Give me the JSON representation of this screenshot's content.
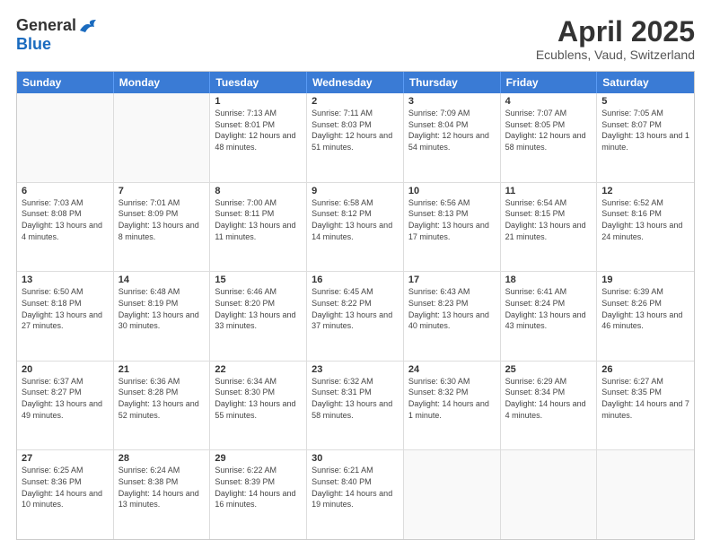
{
  "logo": {
    "general": "General",
    "blue": "Blue"
  },
  "title": "April 2025",
  "subtitle": "Ecublens, Vaud, Switzerland",
  "header_days": [
    "Sunday",
    "Monday",
    "Tuesday",
    "Wednesday",
    "Thursday",
    "Friday",
    "Saturday"
  ],
  "weeks": [
    [
      {
        "day": "",
        "info": ""
      },
      {
        "day": "",
        "info": ""
      },
      {
        "day": "1",
        "info": "Sunrise: 7:13 AM\nSunset: 8:01 PM\nDaylight: 12 hours and 48 minutes."
      },
      {
        "day": "2",
        "info": "Sunrise: 7:11 AM\nSunset: 8:03 PM\nDaylight: 12 hours and 51 minutes."
      },
      {
        "day": "3",
        "info": "Sunrise: 7:09 AM\nSunset: 8:04 PM\nDaylight: 12 hours and 54 minutes."
      },
      {
        "day": "4",
        "info": "Sunrise: 7:07 AM\nSunset: 8:05 PM\nDaylight: 12 hours and 58 minutes."
      },
      {
        "day": "5",
        "info": "Sunrise: 7:05 AM\nSunset: 8:07 PM\nDaylight: 13 hours and 1 minute."
      }
    ],
    [
      {
        "day": "6",
        "info": "Sunrise: 7:03 AM\nSunset: 8:08 PM\nDaylight: 13 hours and 4 minutes."
      },
      {
        "day": "7",
        "info": "Sunrise: 7:01 AM\nSunset: 8:09 PM\nDaylight: 13 hours and 8 minutes."
      },
      {
        "day": "8",
        "info": "Sunrise: 7:00 AM\nSunset: 8:11 PM\nDaylight: 13 hours and 11 minutes."
      },
      {
        "day": "9",
        "info": "Sunrise: 6:58 AM\nSunset: 8:12 PM\nDaylight: 13 hours and 14 minutes."
      },
      {
        "day": "10",
        "info": "Sunrise: 6:56 AM\nSunset: 8:13 PM\nDaylight: 13 hours and 17 minutes."
      },
      {
        "day": "11",
        "info": "Sunrise: 6:54 AM\nSunset: 8:15 PM\nDaylight: 13 hours and 21 minutes."
      },
      {
        "day": "12",
        "info": "Sunrise: 6:52 AM\nSunset: 8:16 PM\nDaylight: 13 hours and 24 minutes."
      }
    ],
    [
      {
        "day": "13",
        "info": "Sunrise: 6:50 AM\nSunset: 8:18 PM\nDaylight: 13 hours and 27 minutes."
      },
      {
        "day": "14",
        "info": "Sunrise: 6:48 AM\nSunset: 8:19 PM\nDaylight: 13 hours and 30 minutes."
      },
      {
        "day": "15",
        "info": "Sunrise: 6:46 AM\nSunset: 8:20 PM\nDaylight: 13 hours and 33 minutes."
      },
      {
        "day": "16",
        "info": "Sunrise: 6:45 AM\nSunset: 8:22 PM\nDaylight: 13 hours and 37 minutes."
      },
      {
        "day": "17",
        "info": "Sunrise: 6:43 AM\nSunset: 8:23 PM\nDaylight: 13 hours and 40 minutes."
      },
      {
        "day": "18",
        "info": "Sunrise: 6:41 AM\nSunset: 8:24 PM\nDaylight: 13 hours and 43 minutes."
      },
      {
        "day": "19",
        "info": "Sunrise: 6:39 AM\nSunset: 8:26 PM\nDaylight: 13 hours and 46 minutes."
      }
    ],
    [
      {
        "day": "20",
        "info": "Sunrise: 6:37 AM\nSunset: 8:27 PM\nDaylight: 13 hours and 49 minutes."
      },
      {
        "day": "21",
        "info": "Sunrise: 6:36 AM\nSunset: 8:28 PM\nDaylight: 13 hours and 52 minutes."
      },
      {
        "day": "22",
        "info": "Sunrise: 6:34 AM\nSunset: 8:30 PM\nDaylight: 13 hours and 55 minutes."
      },
      {
        "day": "23",
        "info": "Sunrise: 6:32 AM\nSunset: 8:31 PM\nDaylight: 13 hours and 58 minutes."
      },
      {
        "day": "24",
        "info": "Sunrise: 6:30 AM\nSunset: 8:32 PM\nDaylight: 14 hours and 1 minute."
      },
      {
        "day": "25",
        "info": "Sunrise: 6:29 AM\nSunset: 8:34 PM\nDaylight: 14 hours and 4 minutes."
      },
      {
        "day": "26",
        "info": "Sunrise: 6:27 AM\nSunset: 8:35 PM\nDaylight: 14 hours and 7 minutes."
      }
    ],
    [
      {
        "day": "27",
        "info": "Sunrise: 6:25 AM\nSunset: 8:36 PM\nDaylight: 14 hours and 10 minutes."
      },
      {
        "day": "28",
        "info": "Sunrise: 6:24 AM\nSunset: 8:38 PM\nDaylight: 14 hours and 13 minutes."
      },
      {
        "day": "29",
        "info": "Sunrise: 6:22 AM\nSunset: 8:39 PM\nDaylight: 14 hours and 16 minutes."
      },
      {
        "day": "30",
        "info": "Sunrise: 6:21 AM\nSunset: 8:40 PM\nDaylight: 14 hours and 19 minutes."
      },
      {
        "day": "",
        "info": ""
      },
      {
        "day": "",
        "info": ""
      },
      {
        "day": "",
        "info": ""
      }
    ]
  ]
}
